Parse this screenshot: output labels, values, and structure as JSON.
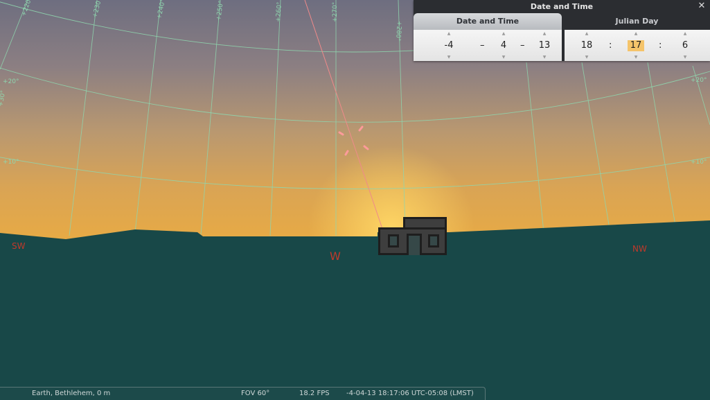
{
  "sky": {
    "compass": {
      "sw": "SW",
      "w": "W",
      "nw": "NW"
    },
    "altitude_labels": {
      "a30": "+30°",
      "a20a": "+20°",
      "a20b": "+20°",
      "a10a": "+10°",
      "a10b": "+10°"
    },
    "azimuth_labels": {
      "z220": "+220°",
      "z230": "+230°",
      "z240": "+240°",
      "z250": "+250°",
      "z260": "+260°",
      "z270": "+270°",
      "z280": "+280°"
    }
  },
  "dialog": {
    "title": "Date and Time",
    "close_glyph": "✕",
    "tabs": {
      "date_time": "Date and Time",
      "julian_day": "Julian Day"
    },
    "date": {
      "year": "-4",
      "month": "4",
      "day": "13"
    },
    "time": {
      "hour": "18",
      "minute": "17",
      "second": "6"
    },
    "separators": {
      "date": "–",
      "time": ":"
    },
    "arrows": {
      "up": "▲",
      "down": "▼"
    }
  },
  "status_bar": {
    "location": "Earth, Bethlehem, 0 m",
    "fov": "FOV 60°",
    "fps": "18.2 FPS",
    "datetime": "-4-04-13 18:17:06 UTC-05:08 (LMST)"
  },
  "colors": {
    "ground": "#184848",
    "grid": "#8fd6ae",
    "cardinal": "#c0392b",
    "selection": "#f5c46a"
  }
}
